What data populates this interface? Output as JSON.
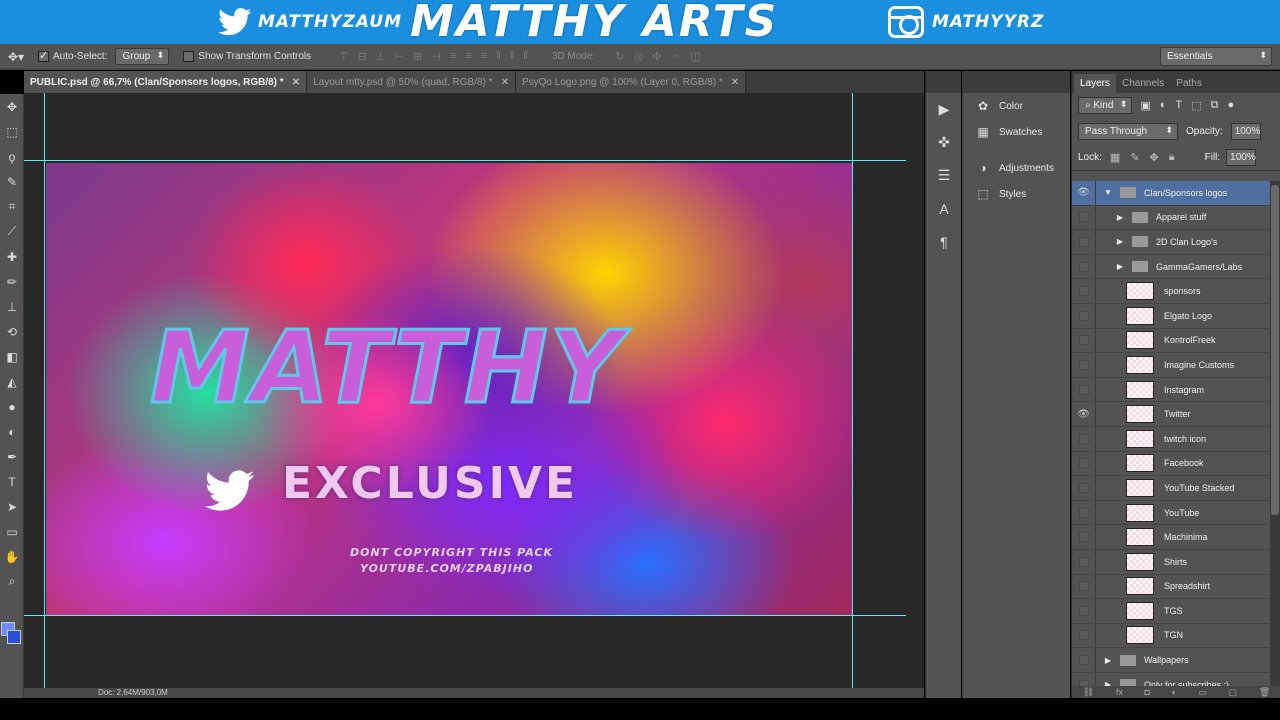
{
  "banner": {
    "twitter_handle": "MATTHYZAUM",
    "title": "MATTHY ARTS",
    "instagram_handle": "MATHYYRZ"
  },
  "options_bar": {
    "auto_select_label": "Auto-Select:",
    "auto_select_checked": true,
    "auto_select_value": "Group",
    "transform_controls_label": "Show Transform Controls",
    "mode_3d_label": "3D Mode:",
    "workspace_value": "Essentials"
  },
  "tabs": [
    {
      "label": "PUBLIC.psd @ 66,7% (Clan/Sponsors logos, RGB/8) *",
      "active": true
    },
    {
      "label": "Layout mtty.psd @ 50% (quad, RGB/8) *",
      "active": false
    },
    {
      "label": "PsyQo Logo.png @ 100% (Layer 0, RGB/8) *",
      "active": false
    }
  ],
  "artwork": {
    "title": "MATTHY",
    "subtitle": "EXCLUSIVE",
    "note_line1": "DONT COPYRIGHT THIS PACK",
    "note_line2": "YOUTUBE.COM/ZPABJIHO"
  },
  "status": {
    "doc_size": "Doc: 2,64M/903,0M"
  },
  "dock_panels": [
    {
      "label": "Color",
      "icon": "color-wheel-icon"
    },
    {
      "label": "Swatches",
      "icon": "swatches-grid-icon"
    },
    {
      "label": "Adjustments",
      "icon": "adjustments-icon"
    },
    {
      "label": "Styles",
      "icon": "styles-icon"
    }
  ],
  "layers_panel": {
    "tabs": [
      "Layers",
      "Channels",
      "Paths"
    ],
    "kind_value": "Kind",
    "blend_mode": "Pass Through",
    "opacity_label": "Opacity:",
    "opacity_value": "100%",
    "lock_label": "Lock:",
    "fill_label": "Fill:",
    "fill_value": "100%",
    "layers": [
      {
        "name": "Clan/Sponsors logos",
        "type": "group",
        "expanded": true,
        "visible": true,
        "selected": true,
        "indent": 0
      },
      {
        "name": "Apparel stuff",
        "type": "group",
        "expanded": false,
        "visible": false,
        "indent": 1
      },
      {
        "name": "2D Clan Logo's",
        "type": "group",
        "expanded": false,
        "visible": false,
        "indent": 1
      },
      {
        "name": "GammaGamers/Labs",
        "type": "group",
        "expanded": false,
        "visible": false,
        "indent": 1
      },
      {
        "name": "sponsors",
        "type": "layer",
        "visible": false,
        "indent": 1
      },
      {
        "name": "Elgato Logo",
        "type": "layer",
        "visible": false,
        "indent": 1
      },
      {
        "name": "KontrolFreek",
        "type": "layer",
        "visible": false,
        "indent": 1
      },
      {
        "name": "Imagine Customs",
        "type": "layer",
        "visible": false,
        "indent": 1
      },
      {
        "name": "Instagram",
        "type": "layer",
        "visible": false,
        "indent": 1
      },
      {
        "name": "Twitter",
        "type": "layer",
        "visible": true,
        "indent": 1
      },
      {
        "name": "twitch icon",
        "type": "layer",
        "visible": false,
        "indent": 1
      },
      {
        "name": "Facebook",
        "type": "layer",
        "visible": false,
        "indent": 1
      },
      {
        "name": "YouTube Stacked",
        "type": "layer",
        "visible": false,
        "indent": 1
      },
      {
        "name": "YouTube",
        "type": "layer",
        "visible": false,
        "indent": 1
      },
      {
        "name": "Machinima",
        "type": "layer",
        "visible": false,
        "indent": 1
      },
      {
        "name": "Shirts",
        "type": "layer",
        "visible": false,
        "indent": 1
      },
      {
        "name": "Spreadshirt",
        "type": "layer",
        "visible": false,
        "indent": 1
      },
      {
        "name": "TGS",
        "type": "layer",
        "visible": false,
        "indent": 1
      },
      {
        "name": "TGN",
        "type": "layer",
        "visible": false,
        "indent": 1
      },
      {
        "name": "Wallpapers",
        "type": "group",
        "expanded": false,
        "visible": false,
        "indent": 0
      },
      {
        "name": "Only for subscribes ;)",
        "type": "group",
        "expanded": false,
        "visible": false,
        "indent": 0
      }
    ]
  },
  "colors": {
    "banner": "#1a8fe0",
    "foreground": "#6e8cff",
    "background": "#2a50d8",
    "guide": "#5fe8f0"
  }
}
